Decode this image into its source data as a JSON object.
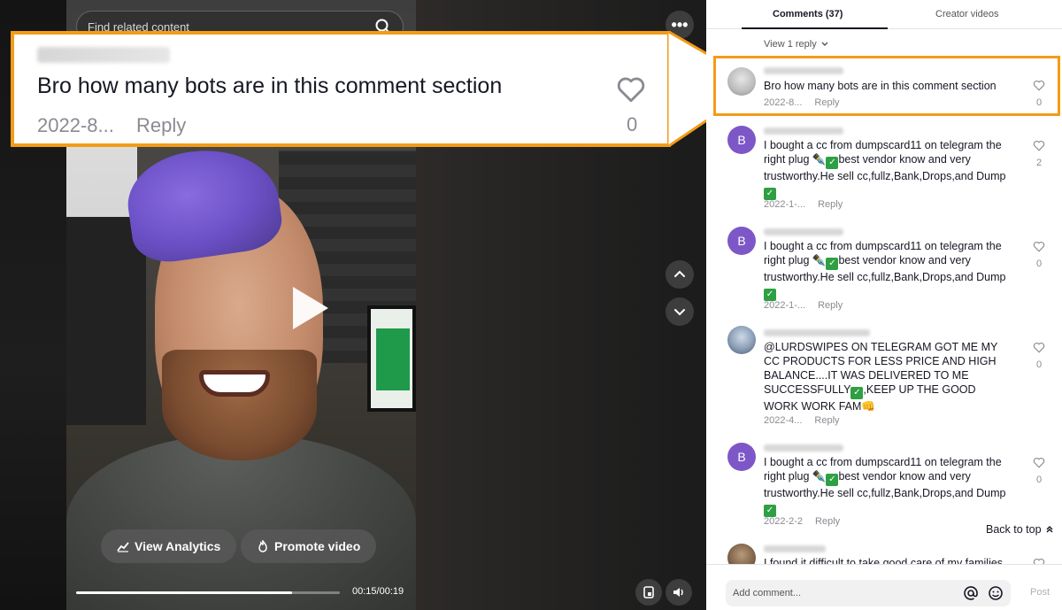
{
  "video": {
    "search_placeholder": "Find related content",
    "analytics_label": "View Analytics",
    "promote_label": "Promote video",
    "time": "00:15/00:19",
    "progress": 0.82
  },
  "callout": {
    "text": "Bro how many bots are in this comment section",
    "date": "2022-8...",
    "reply": "Reply",
    "likes": "0"
  },
  "panel": {
    "tabs": [
      "Comments (37)",
      "Creator videos"
    ],
    "view_reply": "View 1 reply",
    "back_to_top": "Back to top",
    "input_placeholder": "Add comment...",
    "post_label": "Post"
  },
  "comments": [
    {
      "avatar": "",
      "text": "Bro how many bots are in this comment section",
      "date": "2022-8...",
      "reply": "Reply",
      "likes": "0"
    },
    {
      "avatar": "B",
      "text_a": "I bought a cc from dumpscard11 on telegram the right plug ",
      "text_b": "best vendor know and very trustworthy.He sell cc,fullz,Bank,Drops,and Dump",
      "date": "2022-1-...",
      "reply": "Reply",
      "likes": "2"
    },
    {
      "avatar": "B",
      "text_a": "I bought a cc from dumpscard11 on telegram the right plug ",
      "text_b": "best vendor know and very trustworthy.He sell cc,fullz,Bank,Drops,and Dump",
      "date": "2022-1-...",
      "reply": "Reply",
      "likes": "0"
    },
    {
      "avatar": "",
      "text_a": "@LURDSWIPES ON TELEGRAM GOT ME MY CC PRODUCTS FOR LESS PRICE AND HIGH BALANCE....IT WAS DELIVERED TO ME SUCCESSFULLY",
      "text_b": ",KEEP UP THE GOOD WORK WORK FAM",
      "date": "2022-4...",
      "reply": "Reply",
      "likes": "0"
    },
    {
      "avatar": "B",
      "text_a": "I bought a cc from dumpscard11 on telegram the right plug ",
      "text_b": "best vendor know and very trustworthy.He sell cc,fullz,Bank,Drops,and Dump",
      "date": "2022-2-2",
      "reply": "Reply",
      "likes": "0"
    },
    {
      "avatar": "",
      "text": "I found it difficult to take good care of my families"
    }
  ],
  "colors": {
    "accent": "#f39c17",
    "avatar_purple": "#7d57c7",
    "check_green": "#2ea043"
  }
}
